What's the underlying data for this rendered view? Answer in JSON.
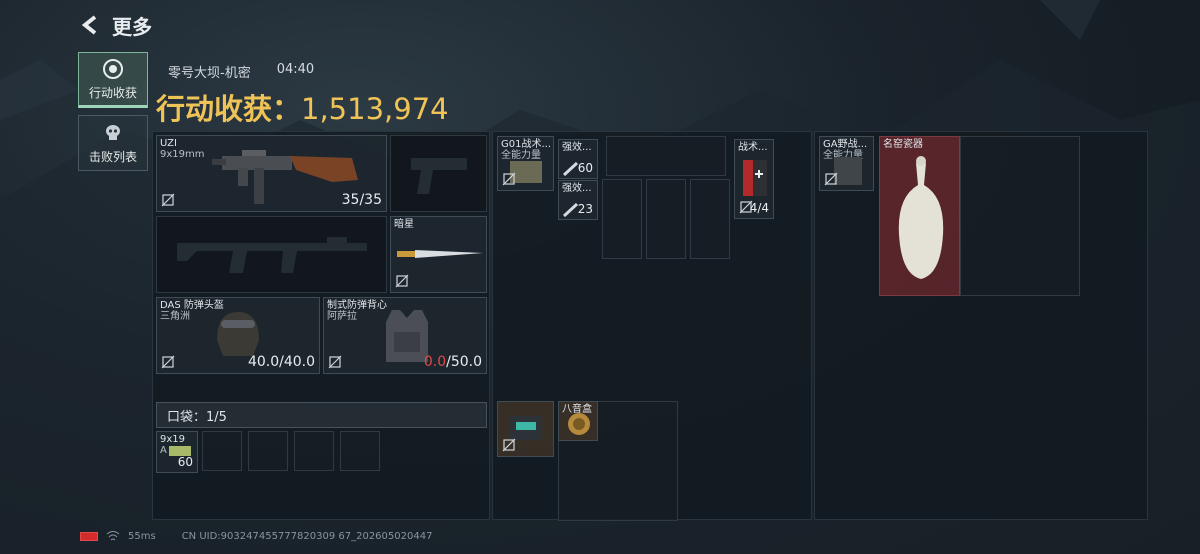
{
  "header": {
    "back_icon": "chevron-left-icon",
    "title": "更多"
  },
  "sidebar": [
    {
      "label": "行动收获",
      "icon": "target-icon",
      "active": true
    },
    {
      "label": "击败列表",
      "icon": "skull-icon",
      "active": false
    }
  ],
  "match": {
    "map": "零号大坝-机密",
    "time": "04:40"
  },
  "income": {
    "label": "行动收获：",
    "value": "1,513,974"
  },
  "weapons": {
    "primary": {
      "name": "UZI",
      "caliber": "9x19mm",
      "ammo": "35/35"
    },
    "melee": {
      "name": "暗星"
    }
  },
  "armor": {
    "helmet": {
      "name": "DAS 防弹头盔",
      "sub": "三角洲",
      "durability": "40.0/40.0"
    },
    "vest": {
      "name": "制式防弹背心",
      "sub": "阿萨拉",
      "durability_current": "0.0",
      "durability_max": "/50.0"
    }
  },
  "pocket": {
    "label": "口袋：1/5"
  },
  "pocket_items": [
    {
      "name": "9x19",
      "sub": "A",
      "count": "60"
    }
  ],
  "chest_rig": {
    "rig": {
      "name": "G01战术...",
      "sub": "全能力量"
    },
    "items": [
      {
        "name": "强效...",
        "count": "60"
      },
      {
        "name": "强效...",
        "count": "23"
      }
    ],
    "tactical": {
      "name": "战术...",
      "count": "4/4"
    }
  },
  "backpack": {
    "bag": {
      "name": "GA野战...",
      "sub": "全能力量"
    },
    "vase": {
      "name": "名窑瓷器"
    }
  },
  "container": {
    "item2": {
      "name": "八音盒"
    }
  },
  "footer": {
    "ping": "55ms",
    "uid": "CN UID:903247455777820309 67_202605020447"
  },
  "colors": {
    "income": "#f0c357",
    "durability_zero": "#e04a4a",
    "accent": "#9fd4b8"
  }
}
